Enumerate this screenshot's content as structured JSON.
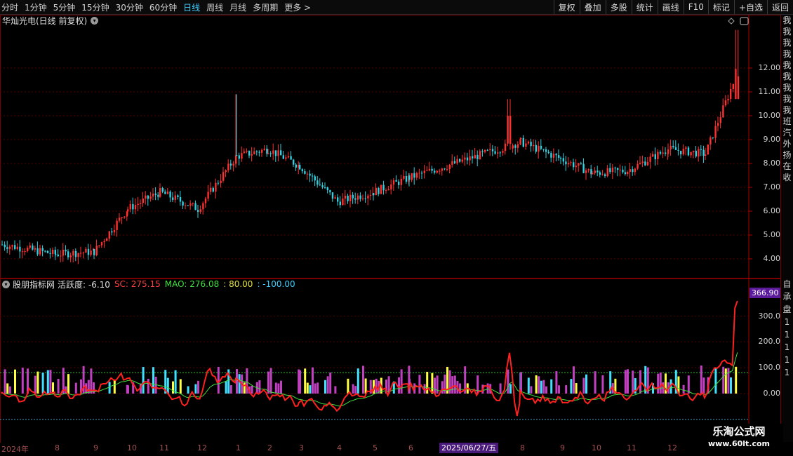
{
  "toolbar": {
    "periods": [
      "分时",
      "1分钟",
      "5分钟",
      "15分钟",
      "30分钟",
      "60分钟",
      "日线",
      "周线",
      "月线",
      "多周期",
      "更多 >"
    ],
    "active_index": 6,
    "actions": [
      "复权",
      "叠加",
      "多股",
      "统计",
      "画线",
      "F10",
      "标记",
      "+自选",
      "返回"
    ]
  },
  "stock": {
    "title": "华灿光电(日线 前复权)",
    "settings_icon": "chevron-down-icon"
  },
  "price_axis": {
    "labels": [
      "12.00",
      "11.00",
      "10.00",
      "9.00",
      "8.00",
      "7.00",
      "6.00",
      "5.00",
      "4.00"
    ]
  },
  "indicator": {
    "name": "股朋指标网",
    "huoyue": "活跃度: -6.10",
    "sc": "SC: 275.15",
    "mao": "MAO: 276.08",
    "level80": ": 80.00",
    "level_neg100": ": -100.00",
    "current_value": "366.90",
    "axis_labels": [
      "300.0",
      "200.0",
      "100.0",
      "0.00"
    ],
    "colors": {
      "huoyue": "#e0e0e0",
      "sc": "#ff4040",
      "mao": "#40e040",
      "level80": "#e0e040",
      "level_neg100": "#40d0ff"
    }
  },
  "right_strip": {
    "top_chars": [
      "我",
      "我",
      "我",
      "我",
      "我",
      "我",
      "我",
      "我",
      "我",
      "班",
      "汽",
      "外",
      "扬",
      "在",
      "收"
    ],
    "bottom_chars": [
      "自",
      "承",
      "盘",
      "1",
      "1",
      "1",
      "1",
      "1"
    ]
  },
  "xaxis": {
    "labels": [
      "2024年",
      "8",
      "9",
      "10",
      "11",
      "12",
      "1",
      "2",
      "3",
      "4",
      "5",
      "6",
      "8",
      "9",
      "10",
      "11",
      "12",
      "1",
      "2"
    ],
    "selected_date": "2025/06/27/五"
  },
  "watermark": {
    "line1": "乐淘公式网",
    "line2": "www.60lt.com"
  },
  "chart_data": {
    "type": "candlestick",
    "title": "华灿光电(日线 前复权)",
    "ylim": [
      3.7,
      13.8
    ],
    "monthly_path": [
      {
        "month": "2024-07",
        "close": 4.6
      },
      {
        "month": "2024-08",
        "close": 4.2
      },
      {
        "month": "2024-09",
        "close": 4.3
      },
      {
        "month": "2024-10",
        "close": 6.1
      },
      {
        "month": "2024-11",
        "close": 6.8
      },
      {
        "month": "2024-12",
        "close": 6.1
      },
      {
        "month": "2025-01",
        "close": 8.3
      },
      {
        "month": "2025-02",
        "close": 8.6
      },
      {
        "month": "2025-03",
        "close": 7.9
      },
      {
        "month": "2025-04",
        "close": 6.4
      },
      {
        "month": "2025-05",
        "close": 6.8
      },
      {
        "month": "2025-06",
        "close": 7.4
      },
      {
        "month": "2025-08",
        "close": 8.9
      },
      {
        "month": "2025-09",
        "close": 8.2
      },
      {
        "month": "2025-10",
        "close": 7.6
      },
      {
        "month": "2025-11",
        "close": 7.7
      },
      {
        "month": "2025-12",
        "close": 8.6
      },
      {
        "month": "2026-01",
        "close": 8.4
      },
      {
        "month": "2026-02",
        "close": 12.0
      }
    ],
    "highs_annotated": {
      "peak_2025_01": 10.9,
      "peak_2025_08": 10.7,
      "recent_peak": 13.6
    }
  }
}
